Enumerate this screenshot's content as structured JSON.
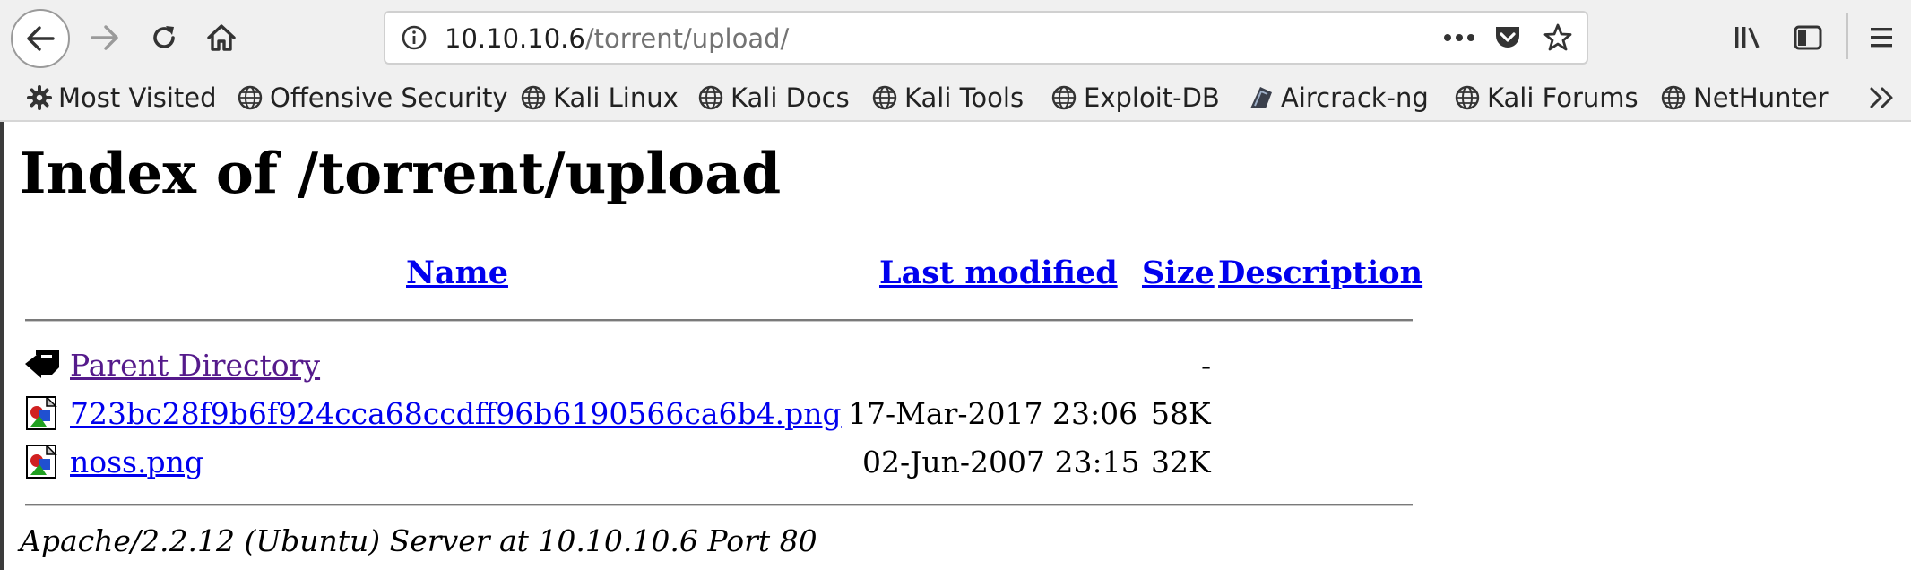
{
  "browser": {
    "url_host": "10.10.10.6",
    "url_path": "/torrent/upload/"
  },
  "bookmarks": [
    {
      "label": "Most Visited",
      "icon": "gear-icon"
    },
    {
      "label": "Offensive Security",
      "icon": "globe-icon"
    },
    {
      "label": "Kali Linux",
      "icon": "globe-icon"
    },
    {
      "label": "Kali Docs",
      "icon": "globe-icon"
    },
    {
      "label": "Kali Tools",
      "icon": "globe-icon"
    },
    {
      "label": "Exploit-DB",
      "icon": "globe-icon"
    },
    {
      "label": "Aircrack-ng",
      "icon": "aircrack-icon"
    },
    {
      "label": "Kali Forums",
      "icon": "globe-icon"
    },
    {
      "label": "NetHunter",
      "icon": "globe-icon"
    }
  ],
  "page": {
    "title": "Index of /torrent/upload",
    "columns": {
      "name": "Name",
      "last_modified": "Last modified",
      "size": "Size",
      "description": "Description"
    },
    "rows": [
      {
        "name": "Parent Directory",
        "modified": "",
        "size": "-",
        "icon": "back-arrow-icon"
      },
      {
        "name": "723bc28f9b6f924cca68ccdff96b6190566ca6b4.png",
        "modified": "17-Mar-2017 23:06",
        "size": "58K",
        "icon": "image-file-icon"
      },
      {
        "name": "noss.png",
        "modified": "02-Jun-2007 23:15",
        "size": "32K",
        "icon": "image-file-icon"
      }
    ],
    "footer": "Apache/2.2.12 (Ubuntu) Server at 10.10.10.6 Port 80"
  }
}
